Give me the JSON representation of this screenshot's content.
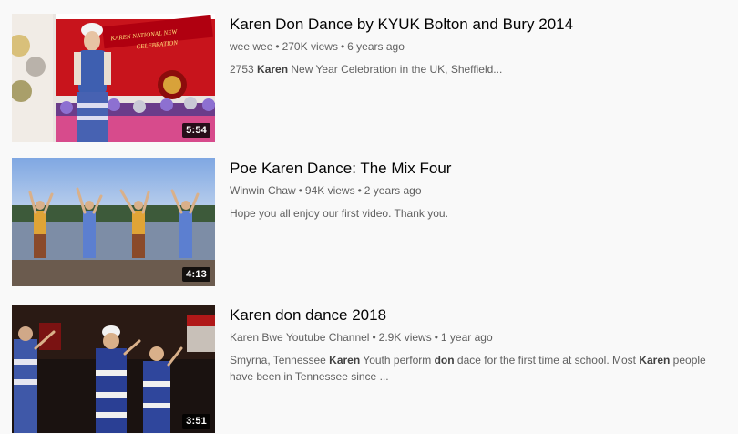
{
  "results": [
    {
      "title": "Karen Don Dance by KYUK Bolton and Bury 2014",
      "channel": "wee wee",
      "views": "270K views",
      "age": "6 years ago",
      "separator": "•",
      "duration": "5:54",
      "banner_text_1": "KAREN NATIONAL NEW",
      "banner_text_2": "CELEBRATION",
      "description": [
        {
          "text": "2753 ",
          "bold": false
        },
        {
          "text": "Karen",
          "bold": true
        },
        {
          "text": " New Year Celebration in the UK, Sheffield...",
          "bold": false
        }
      ]
    },
    {
      "title": "Poe Karen Dance: The Mix Four",
      "channel": "Winwin Chaw",
      "views": "94K views",
      "age": "2 years ago",
      "separator": "•",
      "duration": "4:13",
      "description": [
        {
          "text": "Hope you all enjoy our first video. Thank you.",
          "bold": false
        }
      ]
    },
    {
      "title": "Karen don dance 2018",
      "channel": "Karen Bwe Youtube Channel",
      "views": "2.9K views",
      "age": "1 year ago",
      "separator": "•",
      "duration": "3:51",
      "description": [
        {
          "text": "Smyrna, Tennessee ",
          "bold": false
        },
        {
          "text": "Karen",
          "bold": true
        },
        {
          "text": " Youth perform ",
          "bold": false
        },
        {
          "text": "don",
          "bold": true
        },
        {
          "text": " dace for the first time at school. Most ",
          "bold": false
        },
        {
          "text": "Karen",
          "bold": true
        },
        {
          "text": " people have been in Tennessee since ...",
          "bold": false
        }
      ]
    }
  ],
  "colors": {
    "title": "#030303",
    "meta": "#606060",
    "background": "#f9f9f9",
    "duration_bg": "#000000"
  }
}
